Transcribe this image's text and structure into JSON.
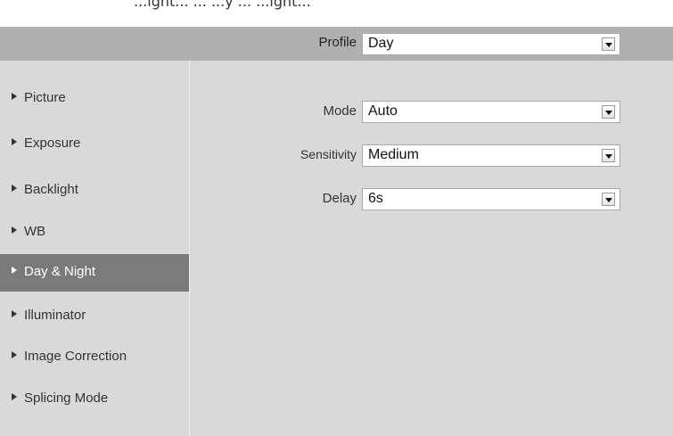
{
  "top_caption": "...ight... ... ...y ... ...ight...",
  "profile": {
    "label": "Profile",
    "value": "Day"
  },
  "sidebar": {
    "items": [
      {
        "label": "Picture"
      },
      {
        "label": "Exposure"
      },
      {
        "label": "Backlight"
      },
      {
        "label": "WB"
      },
      {
        "label": "Day & Night",
        "active": true
      },
      {
        "label": "Illuminator"
      },
      {
        "label": "Image Correction"
      },
      {
        "label": "Splicing Mode"
      }
    ]
  },
  "settings": {
    "mode": {
      "label": "Mode",
      "value": "Auto"
    },
    "sensitivity": {
      "label": "Sensitivity",
      "value": "Medium"
    },
    "delay": {
      "label": "Delay",
      "value": "6s"
    }
  },
  "colors": {
    "profile_bar": "#b0b0b0",
    "panel_bg": "#d9d9d9",
    "active_item_bg": "#7a7a7a"
  }
}
